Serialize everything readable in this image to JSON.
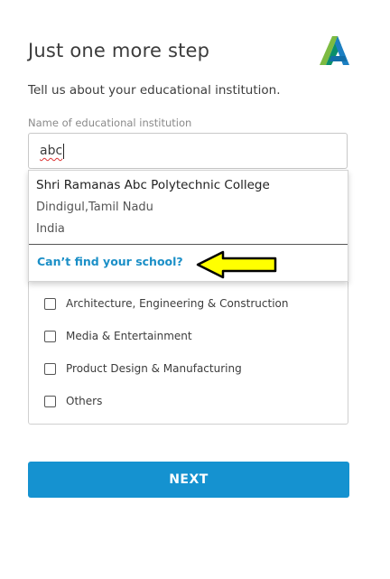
{
  "header": {
    "title": "Just one more step",
    "logo_icon": "autodesk-logo-icon"
  },
  "subtitle": "Tell us about your educational institution.",
  "institution_field": {
    "label": "Name of educational institution",
    "value": "abc"
  },
  "dropdown": {
    "suggestions": [
      {
        "name": "Shri Ramanas Abc Polytechnic College",
        "region": "Dindigul,Tamil Nadu",
        "country": "India"
      }
    ],
    "cant_find_link": "Can’t find your school?"
  },
  "annotation": {
    "icon": "yellow-arrow-pointer-icon",
    "color": "#ffff00"
  },
  "industry_options": [
    {
      "label": "Architecture, Engineering & Construction",
      "checked": false
    },
    {
      "label": "Media & Entertainment",
      "checked": false
    },
    {
      "label": "Product Design & Manufacturing",
      "checked": false
    },
    {
      "label": "Others",
      "checked": false
    }
  ],
  "next_button": {
    "label": "NEXT",
    "color": "#1592d0"
  }
}
